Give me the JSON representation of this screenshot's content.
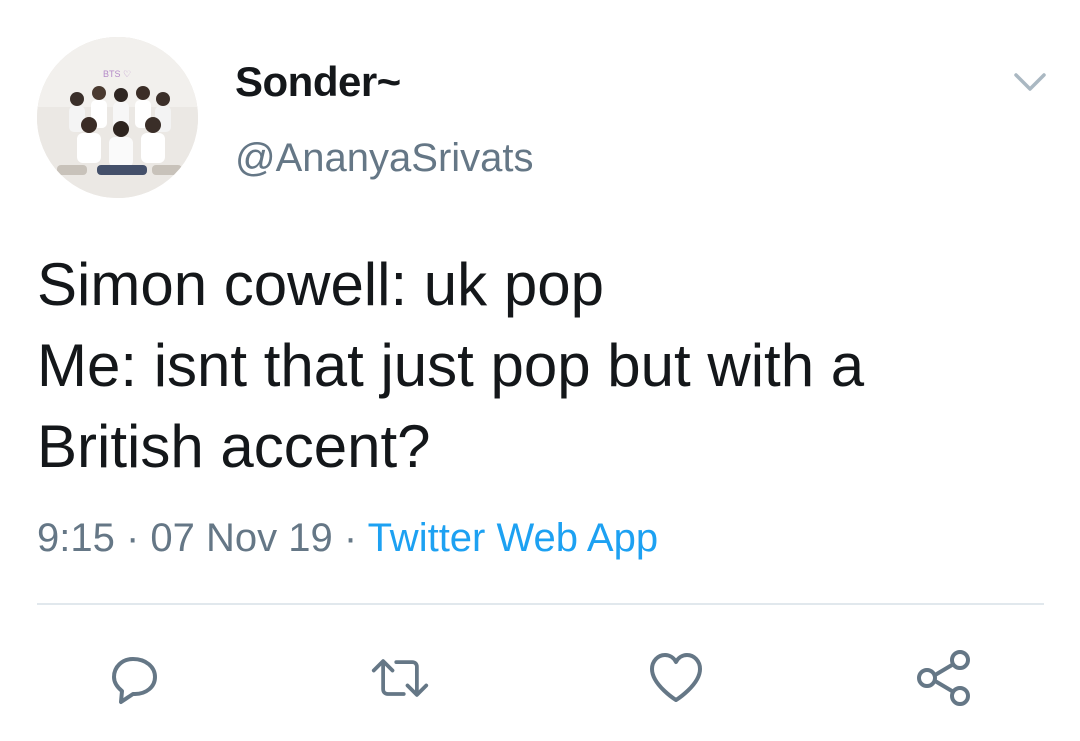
{
  "author": {
    "display_name": "Sonder~",
    "handle": "@AnanyaSrivats",
    "avatar_text": "BTS ♡"
  },
  "tweet": {
    "lines": [
      "Simon cowell: uk pop",
      "Me: isnt that just pop but with a",
      "British accent?"
    ]
  },
  "meta": {
    "time": "9:15",
    "separator": " · ",
    "date": "07 Nov 19",
    "source": "Twitter Web App"
  },
  "actions": {
    "reply_icon": "reply-icon",
    "retweet_icon": "retweet-icon",
    "like_icon": "heart-icon",
    "share_icon": "share-icon"
  },
  "colors": {
    "text": "#14171a",
    "secondary": "#657786",
    "link": "#1da1f2",
    "divider": "#e1e8ed"
  }
}
